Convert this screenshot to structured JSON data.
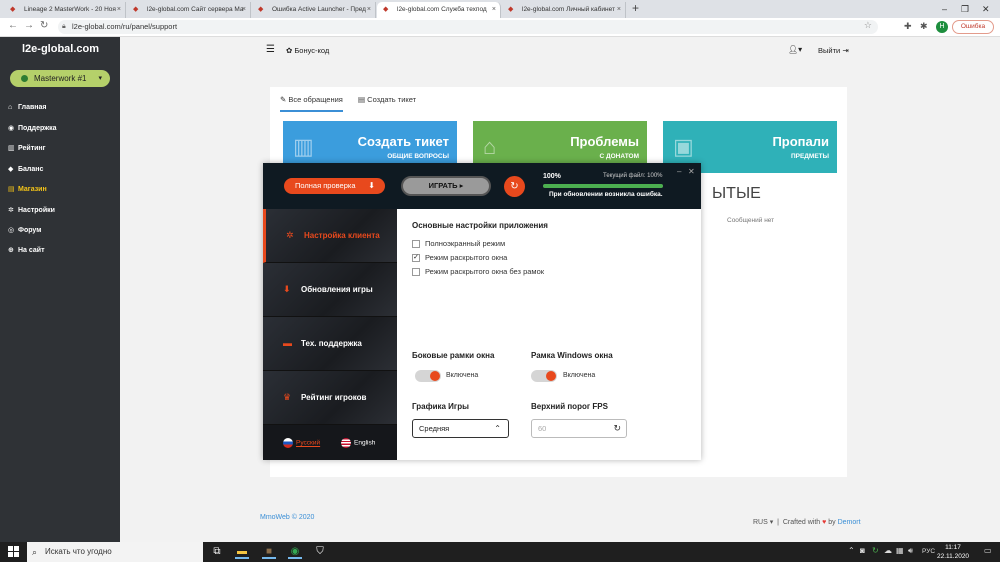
{
  "browser": {
    "tabs": [
      {
        "title": "Lineage 2 MasterWork - 20 Ноя"
      },
      {
        "title": "l2e-global.com Сайт сервера Ма"
      },
      {
        "title": "Ошибка Active Launcher - Пред"
      },
      {
        "title": "l2e-global.com Служба техпод"
      },
      {
        "title": "l2e-global.com Личный кабинет"
      }
    ],
    "new_tab": "+",
    "url": "l2e-global.com/ru/panel/support",
    "profile_letter": "H",
    "error_label": "Ошибка"
  },
  "sidebar": {
    "brand": "l2e-global.com",
    "server": "Masterwork #1",
    "items": [
      {
        "label": "Главная",
        "icon": "home-icon",
        "glyph": "⌂"
      },
      {
        "label": "Поддержка",
        "icon": "lifebuoy-icon",
        "glyph": "◉"
      },
      {
        "label": "Рейтинг",
        "icon": "chart-icon",
        "glyph": "▥"
      },
      {
        "label": "Баланс",
        "icon": "diamond-icon",
        "glyph": "◆"
      },
      {
        "label": "Магазин",
        "icon": "cart-icon",
        "glyph": "▤"
      },
      {
        "label": "Настройки",
        "icon": "gear-icon",
        "glyph": "✲"
      },
      {
        "label": "Форум",
        "icon": "forum-icon",
        "glyph": "◎"
      },
      {
        "label": "На сайт",
        "icon": "globe-icon",
        "glyph": "⊕"
      }
    ],
    "active_color": "#f5c518"
  },
  "header": {
    "bonus_label": "Бонус-код",
    "logout_label": "Выйти"
  },
  "support": {
    "tabs": [
      {
        "label": "Все обращения"
      },
      {
        "label": "Создать тикет"
      }
    ],
    "cards": [
      {
        "title": "Создать тикет",
        "subtitle": "ОБЩИЕ ВОПРОСЫ",
        "color": "#3b9ddd"
      },
      {
        "title": "Проблемы",
        "subtitle": "С ДОНАТОМ",
        "color": "#6ab04c"
      },
      {
        "title": "Пропали",
        "subtitle": "ПРЕДМЕТЫ",
        "color": "#2fb1b8"
      }
    ],
    "closed_title_fragment": "ЫТЫЕ",
    "no_messages": "Сообщений нет"
  },
  "footer": {
    "copyright": "MmoWeb © 2020",
    "lang": "RUS",
    "crafted": "Crafted with",
    "author": "Demort"
  },
  "launcher": {
    "check_button": "Полная проверка",
    "play_button": "ИГРАТЬ ▸",
    "progress_percent": "100%",
    "progress_value": 100,
    "current_file_label": "Текущий файл:",
    "current_file_percent": "100%",
    "update_error": "При обновлении возникла ошибка.",
    "accent": "#e8491d",
    "nav": [
      {
        "label": "Настройка клиента",
        "glyph": "✲"
      },
      {
        "label": "Обновления игры",
        "glyph": "⬇"
      },
      {
        "label": "Тех. поддержка",
        "glyph": "▬"
      },
      {
        "label": "Рейтинг игроков",
        "glyph": "♛"
      }
    ],
    "languages": [
      {
        "label": "Русский"
      },
      {
        "label": "English"
      }
    ],
    "settings": {
      "title": "Основные настройки приложения",
      "options": [
        {
          "label": "Полноэкранный режим",
          "checked": false
        },
        {
          "label": "Режим раскрытого окна",
          "checked": true
        },
        {
          "label": "Режим раскрытого окна без рамок",
          "checked": false
        }
      ],
      "side_frames_title": "Боковые рамки окна",
      "side_frames_value": "Включена",
      "windows_frame_title": "Рамка Windows окна",
      "windows_frame_value": "Включена",
      "graphics_title": "Графика Игры",
      "graphics_value": "Средняя",
      "fps_title": "Верхний порог FPS",
      "fps_placeholder": "60"
    }
  },
  "taskbar": {
    "search_placeholder": "Искать что угодно",
    "lang": "РУС",
    "time": "11:17",
    "date": "22.11.2020"
  }
}
